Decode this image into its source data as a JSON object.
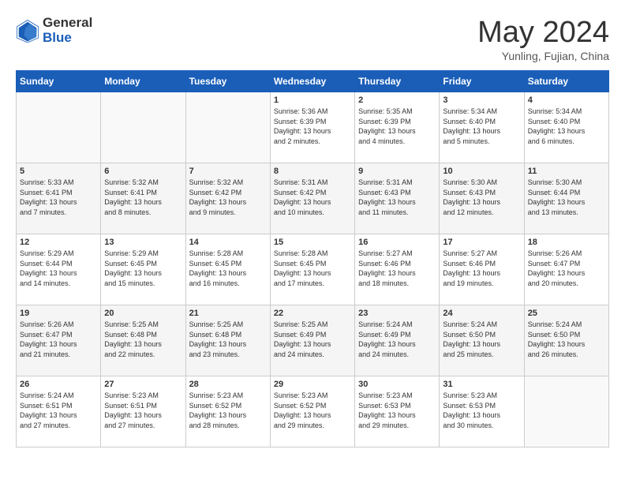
{
  "header": {
    "logo_general": "General",
    "logo_blue": "Blue",
    "month_title": "May 2024",
    "location": "Yunling, Fujian, China"
  },
  "days_of_week": [
    "Sunday",
    "Monday",
    "Tuesday",
    "Wednesday",
    "Thursday",
    "Friday",
    "Saturday"
  ],
  "weeks": [
    [
      {
        "day": "",
        "info": ""
      },
      {
        "day": "",
        "info": ""
      },
      {
        "day": "",
        "info": ""
      },
      {
        "day": "1",
        "info": "Sunrise: 5:36 AM\nSunset: 6:39 PM\nDaylight: 13 hours\nand 2 minutes."
      },
      {
        "day": "2",
        "info": "Sunrise: 5:35 AM\nSunset: 6:39 PM\nDaylight: 13 hours\nand 4 minutes."
      },
      {
        "day": "3",
        "info": "Sunrise: 5:34 AM\nSunset: 6:40 PM\nDaylight: 13 hours\nand 5 minutes."
      },
      {
        "day": "4",
        "info": "Sunrise: 5:34 AM\nSunset: 6:40 PM\nDaylight: 13 hours\nand 6 minutes."
      }
    ],
    [
      {
        "day": "5",
        "info": "Sunrise: 5:33 AM\nSunset: 6:41 PM\nDaylight: 13 hours\nand 7 minutes."
      },
      {
        "day": "6",
        "info": "Sunrise: 5:32 AM\nSunset: 6:41 PM\nDaylight: 13 hours\nand 8 minutes."
      },
      {
        "day": "7",
        "info": "Sunrise: 5:32 AM\nSunset: 6:42 PM\nDaylight: 13 hours\nand 9 minutes."
      },
      {
        "day": "8",
        "info": "Sunrise: 5:31 AM\nSunset: 6:42 PM\nDaylight: 13 hours\nand 10 minutes."
      },
      {
        "day": "9",
        "info": "Sunrise: 5:31 AM\nSunset: 6:43 PM\nDaylight: 13 hours\nand 11 minutes."
      },
      {
        "day": "10",
        "info": "Sunrise: 5:30 AM\nSunset: 6:43 PM\nDaylight: 13 hours\nand 12 minutes."
      },
      {
        "day": "11",
        "info": "Sunrise: 5:30 AM\nSunset: 6:44 PM\nDaylight: 13 hours\nand 13 minutes."
      }
    ],
    [
      {
        "day": "12",
        "info": "Sunrise: 5:29 AM\nSunset: 6:44 PM\nDaylight: 13 hours\nand 14 minutes."
      },
      {
        "day": "13",
        "info": "Sunrise: 5:29 AM\nSunset: 6:45 PM\nDaylight: 13 hours\nand 15 minutes."
      },
      {
        "day": "14",
        "info": "Sunrise: 5:28 AM\nSunset: 6:45 PM\nDaylight: 13 hours\nand 16 minutes."
      },
      {
        "day": "15",
        "info": "Sunrise: 5:28 AM\nSunset: 6:45 PM\nDaylight: 13 hours\nand 17 minutes."
      },
      {
        "day": "16",
        "info": "Sunrise: 5:27 AM\nSunset: 6:46 PM\nDaylight: 13 hours\nand 18 minutes."
      },
      {
        "day": "17",
        "info": "Sunrise: 5:27 AM\nSunset: 6:46 PM\nDaylight: 13 hours\nand 19 minutes."
      },
      {
        "day": "18",
        "info": "Sunrise: 5:26 AM\nSunset: 6:47 PM\nDaylight: 13 hours\nand 20 minutes."
      }
    ],
    [
      {
        "day": "19",
        "info": "Sunrise: 5:26 AM\nSunset: 6:47 PM\nDaylight: 13 hours\nand 21 minutes."
      },
      {
        "day": "20",
        "info": "Sunrise: 5:25 AM\nSunset: 6:48 PM\nDaylight: 13 hours\nand 22 minutes."
      },
      {
        "day": "21",
        "info": "Sunrise: 5:25 AM\nSunset: 6:48 PM\nDaylight: 13 hours\nand 23 minutes."
      },
      {
        "day": "22",
        "info": "Sunrise: 5:25 AM\nSunset: 6:49 PM\nDaylight: 13 hours\nand 24 minutes."
      },
      {
        "day": "23",
        "info": "Sunrise: 5:24 AM\nSunset: 6:49 PM\nDaylight: 13 hours\nand 24 minutes."
      },
      {
        "day": "24",
        "info": "Sunrise: 5:24 AM\nSunset: 6:50 PM\nDaylight: 13 hours\nand 25 minutes."
      },
      {
        "day": "25",
        "info": "Sunrise: 5:24 AM\nSunset: 6:50 PM\nDaylight: 13 hours\nand 26 minutes."
      }
    ],
    [
      {
        "day": "26",
        "info": "Sunrise: 5:24 AM\nSunset: 6:51 PM\nDaylight: 13 hours\nand 27 minutes."
      },
      {
        "day": "27",
        "info": "Sunrise: 5:23 AM\nSunset: 6:51 PM\nDaylight: 13 hours\nand 27 minutes."
      },
      {
        "day": "28",
        "info": "Sunrise: 5:23 AM\nSunset: 6:52 PM\nDaylight: 13 hours\nand 28 minutes."
      },
      {
        "day": "29",
        "info": "Sunrise: 5:23 AM\nSunset: 6:52 PM\nDaylight: 13 hours\nand 29 minutes."
      },
      {
        "day": "30",
        "info": "Sunrise: 5:23 AM\nSunset: 6:53 PM\nDaylight: 13 hours\nand 29 minutes."
      },
      {
        "day": "31",
        "info": "Sunrise: 5:23 AM\nSunset: 6:53 PM\nDaylight: 13 hours\nand 30 minutes."
      },
      {
        "day": "",
        "info": ""
      }
    ]
  ]
}
